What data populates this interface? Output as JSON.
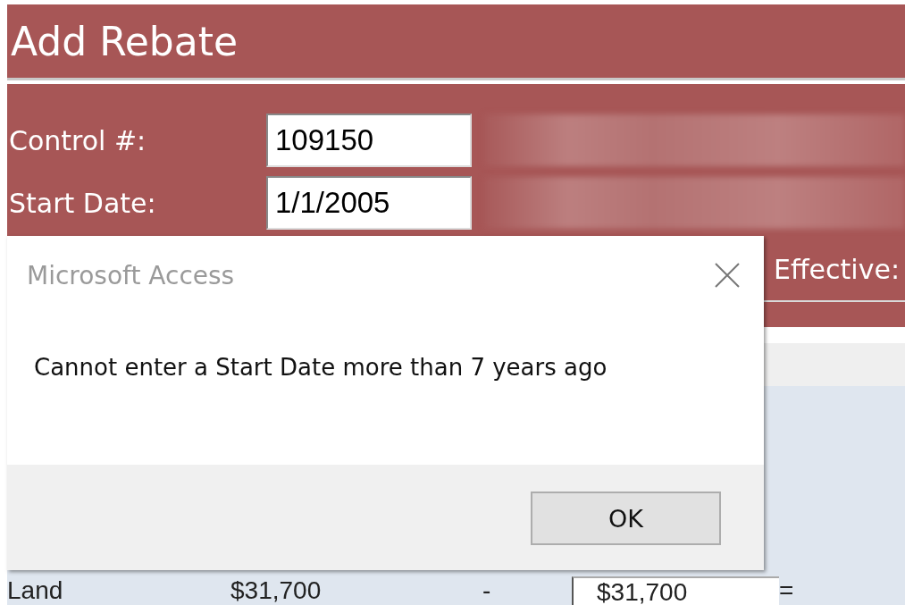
{
  "form": {
    "title": "Add Rebate",
    "fields": [
      {
        "label": "Control #:",
        "value": "109150"
      },
      {
        "label": "Start Date:",
        "value": "1/1/2005"
      }
    ],
    "effective_label": "Effective:",
    "row": [
      {
        "kind": "text",
        "text": "Land"
      },
      {
        "kind": "text",
        "text": "$31,700"
      },
      {
        "kind": "text",
        "text": "-"
      },
      {
        "kind": "field",
        "text": "$31,700"
      },
      {
        "kind": "text",
        "text": "="
      }
    ]
  },
  "dialog": {
    "title": "Microsoft Access",
    "message": "Cannot enter a Start Date more than 7 years ago",
    "buttons": [
      "OK"
    ]
  }
}
